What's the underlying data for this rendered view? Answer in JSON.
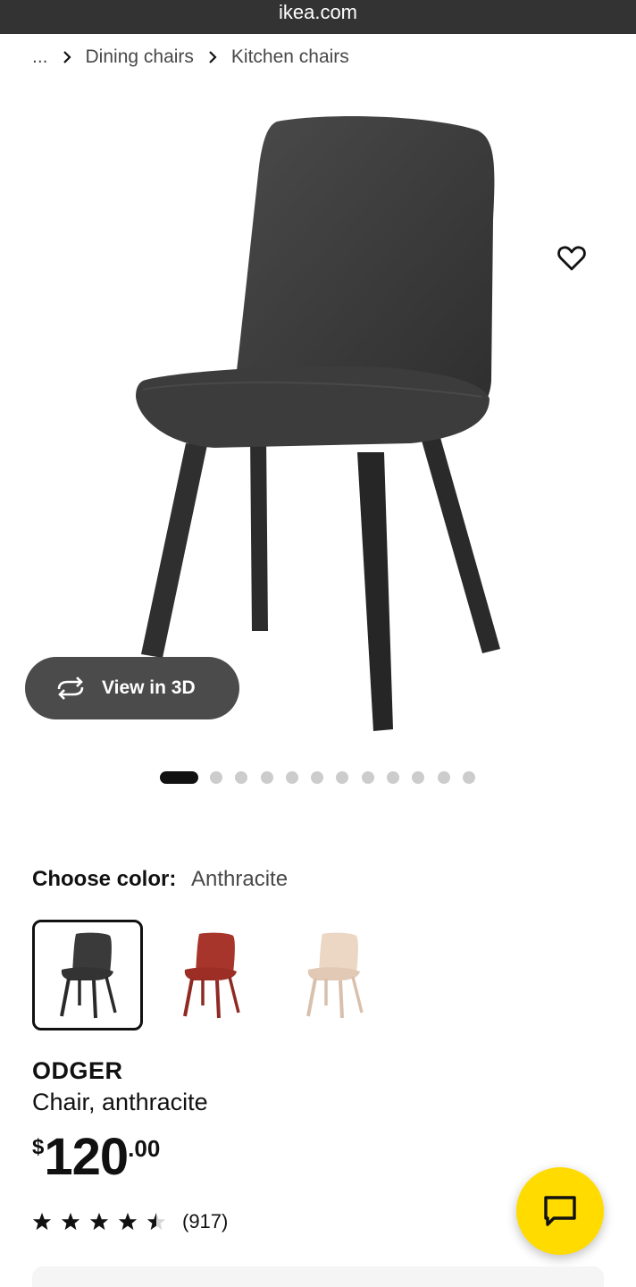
{
  "browser": {
    "url": "ikea.com"
  },
  "breadcrumb": {
    "ellipsis": "...",
    "items": [
      {
        "label": "Dining chairs"
      },
      {
        "label": "Kitchen chairs"
      }
    ]
  },
  "gallery": {
    "favorite_icon": "heart-icon",
    "view3d_label": "View in 3D",
    "view3d_icon": "rotate-icon",
    "image_count": 13,
    "active_index": 0
  },
  "color": {
    "label": "Choose color:",
    "selected": "Anthracite",
    "options": [
      {
        "name": "Anthracite",
        "hex": "#3a3a3a",
        "selected": true
      },
      {
        "name": "Red",
        "hex": "#a8352c",
        "selected": false
      },
      {
        "name": "Beige",
        "hex": "#e8d2c0",
        "selected": false
      }
    ]
  },
  "product": {
    "name": "ODGER",
    "description": "Chair, anthracite",
    "price": {
      "currency": "$",
      "integer": "120",
      "decimal": ".00"
    },
    "rating": {
      "stars": 4.5,
      "count_label": "(917)"
    }
  },
  "chat": {
    "icon": "chat-bubble-icon"
  },
  "colors": {
    "accent": "#FFDB00",
    "text": "#111111",
    "muted": "#484848"
  }
}
